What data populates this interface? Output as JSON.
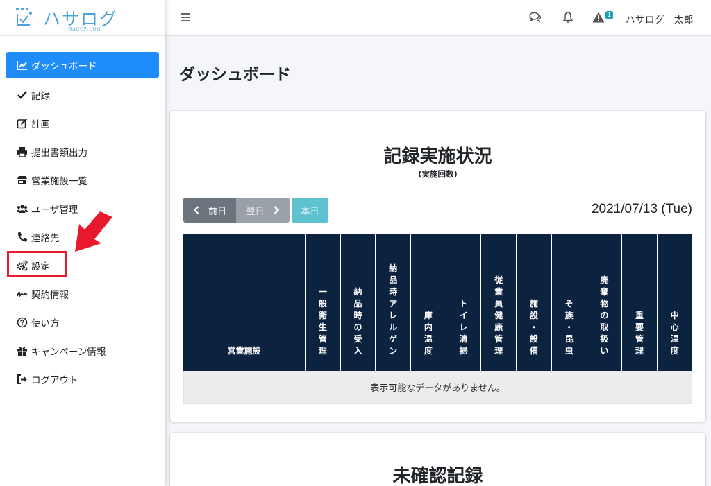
{
  "brand": {
    "title": "ハサログ",
    "subtitle": "HACCP-LOG"
  },
  "sidebar": {
    "items": [
      {
        "label": "ダッシュボード",
        "icon": "chart-line-icon",
        "active": true
      },
      {
        "label": "記録",
        "icon": "check-icon"
      },
      {
        "label": "計画",
        "icon": "edit-icon"
      },
      {
        "label": "提出書類出力",
        "icon": "print-icon"
      },
      {
        "label": "営業施設一覧",
        "icon": "store-icon"
      },
      {
        "label": "ユーザ管理",
        "icon": "users-icon"
      },
      {
        "label": "連絡先",
        "icon": "phone-icon"
      },
      {
        "label": "設定",
        "icon": "cogs-icon"
      },
      {
        "label": "契約情報",
        "icon": "signature-icon"
      },
      {
        "label": "使い方",
        "icon": "question-circle-icon"
      },
      {
        "label": "キャンペーン情報",
        "icon": "gift-icon"
      },
      {
        "label": "ログアウト",
        "icon": "sign-out-icon"
      }
    ]
  },
  "topbar": {
    "notification_count": "1",
    "user_name": "ハサログ　太郎"
  },
  "main": {
    "page_title": "ダッシュボード",
    "record_card": {
      "title": "記録実施状況",
      "subtitle": "(実施回数)",
      "prev_label": "前日",
      "next_label": "翌日",
      "today_label": "本日",
      "date": "2021/07/13 (Tue)",
      "table": {
        "first_header": "営業施設",
        "headers": [
          "一般衛生管理",
          "納品時の受入",
          "納品時アレルゲン",
          "庫内温度",
          "トイレ清掃",
          "従業員健康管理",
          "施設・設備",
          "そ族・昆虫",
          "廃棄物の取扱い",
          "重要管理",
          "中心温度"
        ],
        "empty_message": "表示可能なデータがありません。"
      }
    },
    "unconfirmed_card": {
      "title": "未確認記録"
    }
  },
  "colors": {
    "active_nav": "#1e8cf9",
    "table_header": "#0c2340",
    "highlight": "#e8192c",
    "today_button": "#5ec2d1"
  }
}
